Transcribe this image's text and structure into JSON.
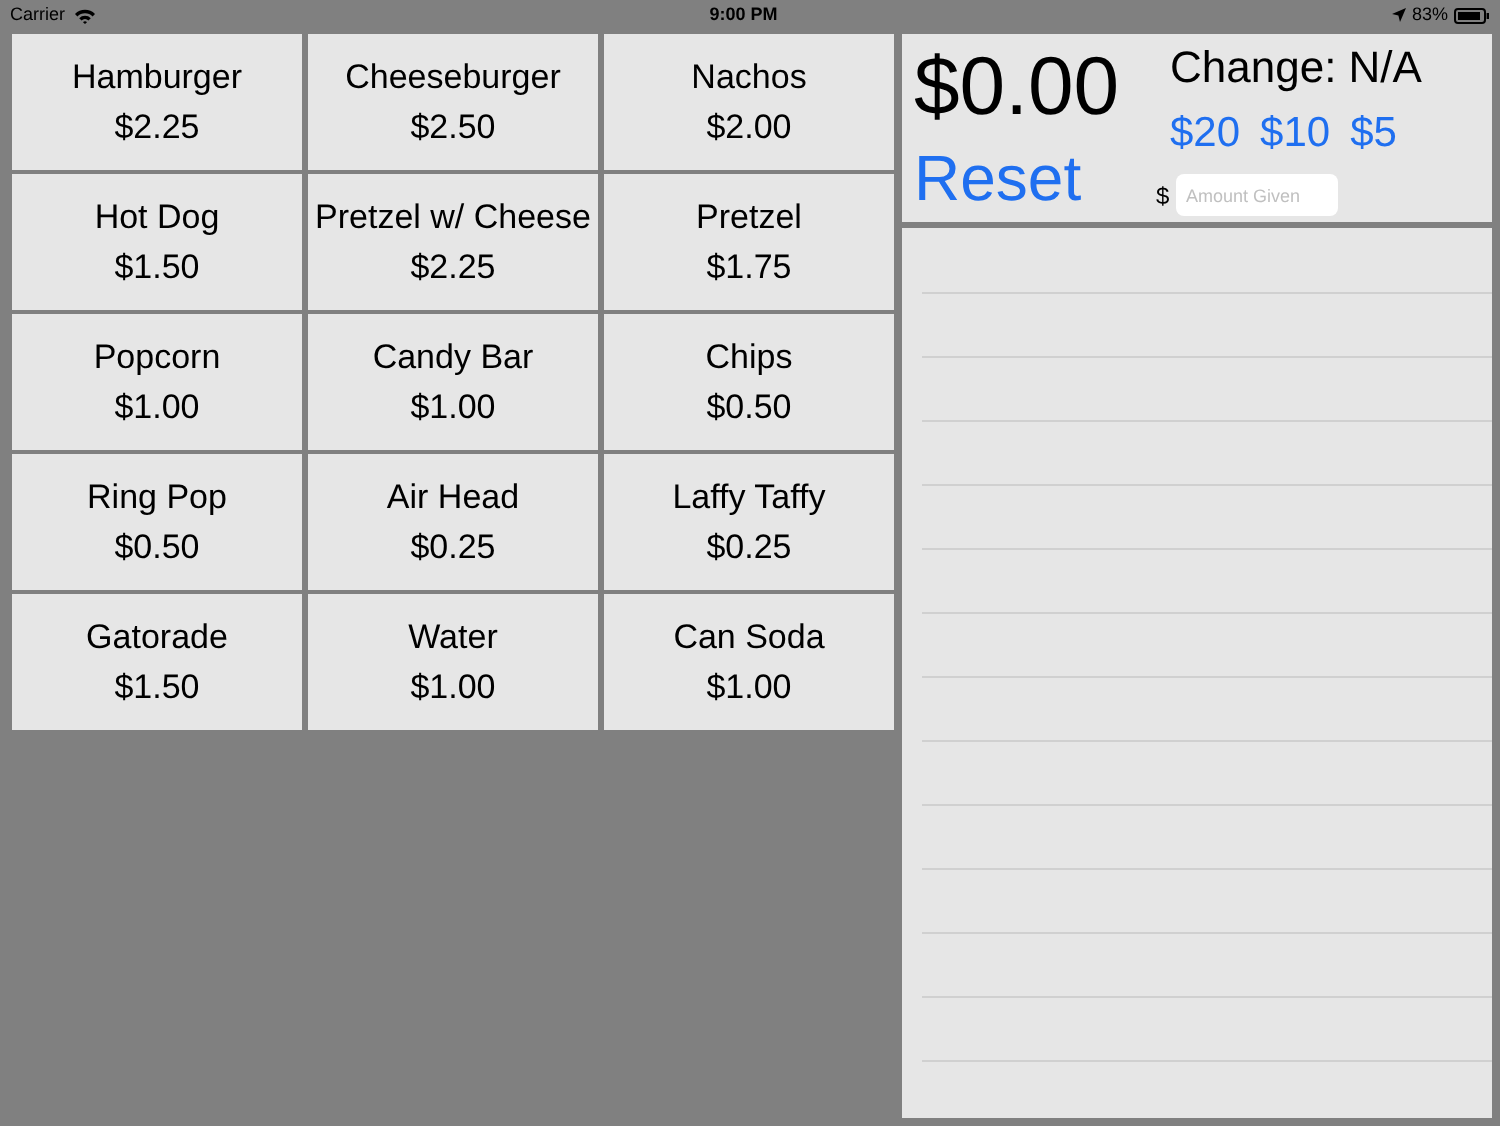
{
  "status_bar": {
    "carrier": "Carrier",
    "time": "9:00 PM",
    "battery": "83%"
  },
  "items": [
    {
      "name": "Hamburger",
      "price": "$2.25"
    },
    {
      "name": "Cheeseburger",
      "price": "$2.50"
    },
    {
      "name": "Nachos",
      "price": "$2.00"
    },
    {
      "name": "Hot Dog",
      "price": "$1.50"
    },
    {
      "name": "Pretzel w/ Cheese",
      "price": "$2.25"
    },
    {
      "name": "Pretzel",
      "price": "$1.75"
    },
    {
      "name": "Popcorn",
      "price": "$1.00"
    },
    {
      "name": "Candy Bar",
      "price": "$1.00"
    },
    {
      "name": "Chips",
      "price": "$0.50"
    },
    {
      "name": "Ring Pop",
      "price": "$0.50"
    },
    {
      "name": "Air Head",
      "price": "$0.25"
    },
    {
      "name": "Laffy Taffy",
      "price": "$0.25"
    },
    {
      "name": "Gatorade",
      "price": "$1.50"
    },
    {
      "name": "Water",
      "price": "$1.00"
    },
    {
      "name": "Can Soda",
      "price": "$1.00"
    }
  ],
  "summary": {
    "total": "$0.00",
    "reset": "Reset",
    "change": "Change: N/A",
    "quick_amounts": [
      "$20",
      "$10",
      "$5"
    ],
    "currency": "$",
    "amount_placeholder": "Amount Given"
  }
}
